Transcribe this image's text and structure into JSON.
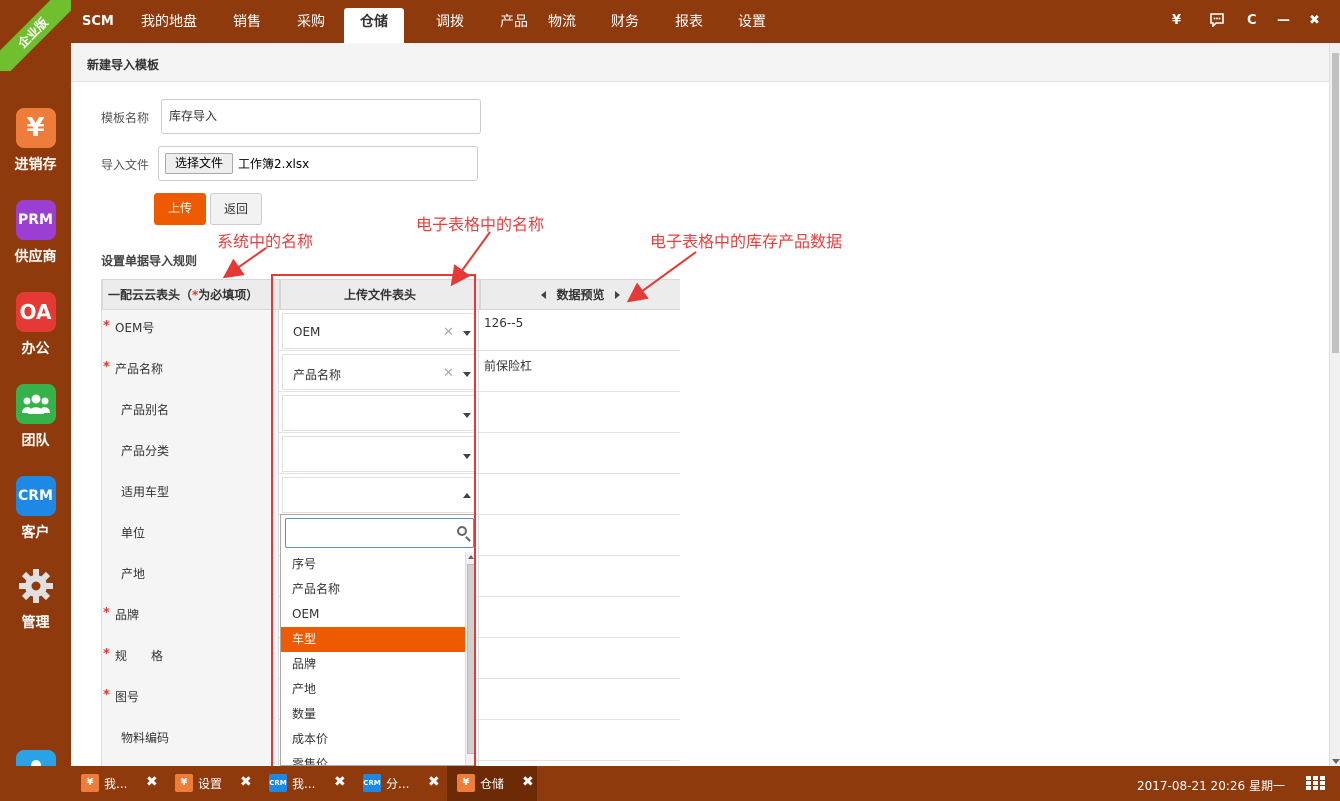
{
  "ribbon": "企业版",
  "sidebar": {
    "items": [
      {
        "icon": "yen-icon",
        "glyph": "¥",
        "label": "进销存",
        "color": "#ee7d3b"
      },
      {
        "icon": "prm-icon",
        "glyph": "PRM",
        "label": "供应商",
        "color": "#9b3fd3"
      },
      {
        "icon": "oa-icon",
        "glyph": "OA",
        "label": "办公",
        "color": "#e53935"
      },
      {
        "icon": "team-icon",
        "glyph": "",
        "label": "团队",
        "color": "#35b34a"
      },
      {
        "icon": "crm-icon",
        "glyph": "CRM",
        "label": "客户",
        "color": "#1e88e5"
      },
      {
        "icon": "gear-icon",
        "glyph": "",
        "label": "管理",
        "color": ""
      }
    ],
    "user_icon": "user-icon"
  },
  "topnav": {
    "brand": "SCM",
    "tabs": [
      "我的地盘",
      "销售",
      "采购",
      "仓储",
      "调拨",
      "产品",
      "物流",
      "财务",
      "报表",
      "设置"
    ],
    "active": "仓储",
    "controls": [
      "¥",
      "💬",
      "C",
      "—",
      "✖"
    ]
  },
  "page": {
    "title": "新建导入模板",
    "template_name_label": "模板名称",
    "template_name_value": "库存导入",
    "file_label": "导入文件",
    "file_button": "选择文件",
    "file_name": "工作簿2.xlsx",
    "upload_button": "上传",
    "back_button": "返回",
    "rules_title": "设置单据导入规则"
  },
  "annotations": {
    "system_names": "系统中的名称",
    "sheet_names": "电子表格中的名称",
    "sheet_data": "电子表格中的库存产品数据"
  },
  "table": {
    "headers": {
      "col1_prefix": "一配云云表头（",
      "col1_star": "*",
      "col1_suffix": "为必填项）",
      "col2": "上传文件表头",
      "col3": "数据预览"
    },
    "rows": [
      {
        "required": true,
        "name": "OEM号",
        "mapped": "OEM",
        "clearable": true,
        "preview": "126--5"
      },
      {
        "required": true,
        "name": "产品名称",
        "mapped": "产品名称",
        "clearable": true,
        "preview": "前保险杠"
      },
      {
        "required": false,
        "name": "产品别名",
        "mapped": "",
        "clearable": false,
        "preview": ""
      },
      {
        "required": false,
        "name": "产品分类",
        "mapped": "",
        "clearable": false,
        "preview": ""
      },
      {
        "required": false,
        "name": "适用车型",
        "mapped": "",
        "clearable": false,
        "preview": "",
        "open": true
      },
      {
        "required": false,
        "name": "单位",
        "mapped": "",
        "clearable": false,
        "preview": ""
      },
      {
        "required": false,
        "name": "产地",
        "mapped": "",
        "clearable": false,
        "preview": ""
      },
      {
        "required": true,
        "name": "品牌",
        "mapped": "",
        "clearable": false,
        "preview": ""
      },
      {
        "required": true,
        "name": "规　　格",
        "mapped": "",
        "clearable": false,
        "preview": ""
      },
      {
        "required": true,
        "name": "图号",
        "mapped": "",
        "clearable": false,
        "preview": ""
      },
      {
        "required": false,
        "name": "物料编码",
        "mapped": "",
        "clearable": false,
        "preview": ""
      },
      {
        "required": false,
        "name": "",
        "mapped": "",
        "clearable": false,
        "preview": ""
      }
    ]
  },
  "dropdown": {
    "search_value": "",
    "options": [
      "序号",
      "产品名称",
      "OEM",
      "车型",
      "品牌",
      "产地",
      "数量",
      "成本价",
      "零售价"
    ],
    "highlighted": "车型"
  },
  "taskbar": {
    "tasks": [
      {
        "icon": "yen-icon",
        "glyph": "¥",
        "label": "我...",
        "color": "#ee7d3b"
      },
      {
        "icon": "yen-icon",
        "glyph": "¥",
        "label": "设置",
        "color": "#ee7d3b"
      },
      {
        "icon": "crm-icon",
        "glyph": "CRM",
        "label": "我...",
        "color": "#1e88e5"
      },
      {
        "icon": "crm-icon",
        "glyph": "CRM",
        "label": "分...",
        "color": "#1e88e5"
      },
      {
        "icon": "yen-icon",
        "glyph": "¥",
        "label": "仓储",
        "color": "#ee7d3b",
        "active": true
      }
    ],
    "close_glyph": "✖",
    "clock": "2017-08-21 20:26 星期一"
  }
}
